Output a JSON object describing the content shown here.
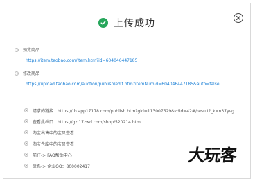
{
  "dialog": {
    "title": "上传成功",
    "preview": {
      "label": "预览商品",
      "url": "https://item.taobao.com/item.htm?id=604046447185"
    },
    "edit": {
      "label": "修改商品",
      "url": "https://upload.taobao.com/auction/publish/edit.htm?itemNumId=604046447185&auto=false"
    },
    "info_items": [
      "请求的链接：https://tb.app17178.com/publish.htm?gid=113007529&zdid=42#/result?_k=n37yvg",
      "查看此档口：https://gz.17zwd.com/shop/520214.htm",
      "淘宝出售中的宝贝查看",
      "淘宝仓库中的宝贝查看",
      "前往-> FAQ帮助中心",
      "联系-> 企业QQ：800002417"
    ]
  },
  "watermark": {
    "text": "大玩客"
  },
  "colors": {
    "success": "#26a65b",
    "link": "#1a7fd6"
  }
}
